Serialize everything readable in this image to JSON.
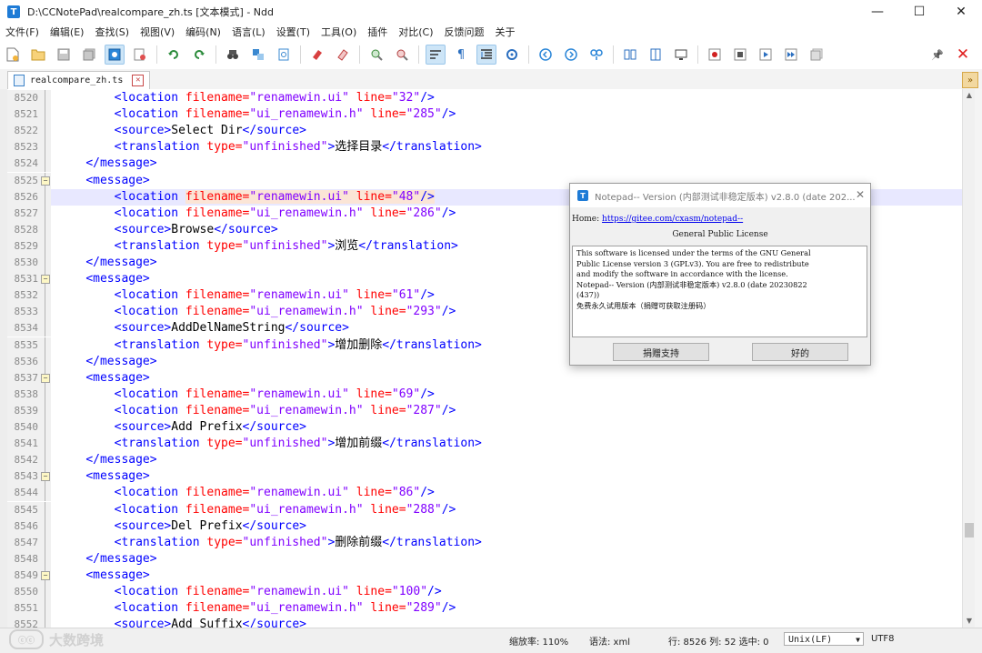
{
  "window": {
    "title": "D:\\CCNotePad\\realcompare_zh.ts [文本模式] - Ndd",
    "app_icon": "T",
    "controls": [
      "minimize-icon",
      "maximize-icon",
      "close-icon"
    ],
    "minimize_glyph": "—",
    "maximize_glyph": "☐",
    "close_glyph": "✕"
  },
  "menu": [
    "文件(F)",
    "编辑(E)",
    "查找(S)",
    "视图(V)",
    "编码(N)",
    "语言(L)",
    "设置(T)",
    "工具(O)",
    "插件",
    "对比(C)",
    "反馈问题",
    "关于"
  ],
  "toolbar": {
    "pin_glyph": "📌",
    "close_glyph": "✕"
  },
  "tab": {
    "label": "realcompare_zh.ts",
    "close_glyph": "✕",
    "scroll_glyph": "»"
  },
  "editor": {
    "current_line": "8526",
    "lines": [
      {
        "n": "8520",
        "fold": "line",
        "indent": "        ",
        "parts": [
          [
            "t-tag",
            "<location "
          ],
          [
            "t-attr",
            "filename="
          ],
          [
            "t-val",
            "\"renamewin.ui\""
          ],
          [
            "t-attr",
            " line="
          ],
          [
            "t-val",
            "\"32\""
          ],
          [
            "t-tag",
            "/>"
          ]
        ]
      },
      {
        "n": "8521",
        "fold": "line",
        "indent": "        ",
        "parts": [
          [
            "t-tag",
            "<location "
          ],
          [
            "t-attr",
            "filename="
          ],
          [
            "t-val",
            "\"ui_renamewin.h\""
          ],
          [
            "t-attr",
            " line="
          ],
          [
            "t-val",
            "\"285\""
          ],
          [
            "t-tag",
            "/>"
          ]
        ]
      },
      {
        "n": "8522",
        "fold": "line",
        "indent": "        ",
        "parts": [
          [
            "t-tag",
            "<source>"
          ],
          [
            "t-text",
            "Select Dir"
          ],
          [
            "t-tag",
            "</source>"
          ]
        ]
      },
      {
        "n": "8523",
        "fold": "line",
        "indent": "        ",
        "parts": [
          [
            "t-tag",
            "<translation "
          ],
          [
            "t-attr",
            "type="
          ],
          [
            "t-val",
            "\"unfinished\""
          ],
          [
            "t-tag",
            ">"
          ],
          [
            "t-text",
            "选择目录"
          ],
          [
            "t-tag",
            "</translation>"
          ]
        ]
      },
      {
        "n": "8524",
        "fold": "line",
        "indent": "    ",
        "parts": [
          [
            "t-tag",
            "</message>"
          ]
        ]
      },
      {
        "n": "8525",
        "fold": "box",
        "indent": "    ",
        "parts": [
          [
            "t-tag",
            "<message>"
          ]
        ]
      },
      {
        "n": "8526",
        "fold": "line",
        "indent": "        ",
        "parts": [
          [
            "t-tag",
            "<location "
          ],
          [
            "t-attr hl",
            "filename="
          ],
          [
            "t-val hl",
            "\"renamewin.ui\""
          ],
          [
            "t-attr hl",
            " line="
          ],
          [
            "t-val hl",
            "\"48\""
          ],
          [
            "t-tag hl",
            "/>"
          ]
        ]
      },
      {
        "n": "8527",
        "fold": "line",
        "indent": "        ",
        "parts": [
          [
            "t-tag",
            "<location "
          ],
          [
            "t-attr",
            "filename="
          ],
          [
            "t-val",
            "\"ui_renamewin.h\""
          ],
          [
            "t-attr",
            " line="
          ],
          [
            "t-val",
            "\"286\""
          ],
          [
            "t-tag",
            "/>"
          ]
        ]
      },
      {
        "n": "8528",
        "fold": "line",
        "indent": "        ",
        "parts": [
          [
            "t-tag",
            "<source>"
          ],
          [
            "t-text",
            "Browse"
          ],
          [
            "t-tag",
            "</source>"
          ]
        ]
      },
      {
        "n": "8529",
        "fold": "line",
        "indent": "        ",
        "parts": [
          [
            "t-tag",
            "<translation "
          ],
          [
            "t-attr",
            "type="
          ],
          [
            "t-val",
            "\"unfinished\""
          ],
          [
            "t-tag",
            ">"
          ],
          [
            "t-text",
            "浏览"
          ],
          [
            "t-tag",
            "</translation>"
          ]
        ]
      },
      {
        "n": "8530",
        "fold": "line",
        "indent": "    ",
        "parts": [
          [
            "t-tag",
            "</message>"
          ]
        ]
      },
      {
        "n": "8531",
        "fold": "box",
        "indent": "    ",
        "parts": [
          [
            "t-tag",
            "<message>"
          ]
        ]
      },
      {
        "n": "8532",
        "fold": "line",
        "indent": "        ",
        "parts": [
          [
            "t-tag",
            "<location "
          ],
          [
            "t-attr",
            "filename="
          ],
          [
            "t-val",
            "\"renamewin.ui\""
          ],
          [
            "t-attr",
            " line="
          ],
          [
            "t-val",
            "\"61\""
          ],
          [
            "t-tag",
            "/>"
          ]
        ]
      },
      {
        "n": "8533",
        "fold": "line",
        "indent": "        ",
        "parts": [
          [
            "t-tag",
            "<location "
          ],
          [
            "t-attr",
            "filename="
          ],
          [
            "t-val",
            "\"ui_renamewin.h\""
          ],
          [
            "t-attr",
            " line="
          ],
          [
            "t-val",
            "\"293\""
          ],
          [
            "t-tag",
            "/>"
          ]
        ]
      },
      {
        "n": "8534",
        "fold": "line",
        "indent": "        ",
        "parts": [
          [
            "t-tag",
            "<source>"
          ],
          [
            "t-text",
            "AddDelNameString"
          ],
          [
            "t-tag",
            "</source>"
          ]
        ]
      },
      {
        "n": "8535",
        "fold": "line",
        "indent": "        ",
        "parts": [
          [
            "t-tag",
            "<translation "
          ],
          [
            "t-attr",
            "type="
          ],
          [
            "t-val",
            "\"unfinished\""
          ],
          [
            "t-tag",
            ">"
          ],
          [
            "t-text",
            "增加删除"
          ],
          [
            "t-tag",
            "</translation>"
          ]
        ]
      },
      {
        "n": "8536",
        "fold": "line",
        "indent": "    ",
        "parts": [
          [
            "t-tag",
            "</message>"
          ]
        ]
      },
      {
        "n": "8537",
        "fold": "box",
        "indent": "    ",
        "parts": [
          [
            "t-tag",
            "<message>"
          ]
        ]
      },
      {
        "n": "8538",
        "fold": "line",
        "indent": "        ",
        "parts": [
          [
            "t-tag",
            "<location "
          ],
          [
            "t-attr",
            "filename="
          ],
          [
            "t-val",
            "\"renamewin.ui\""
          ],
          [
            "t-attr",
            " line="
          ],
          [
            "t-val",
            "\"69\""
          ],
          [
            "t-tag",
            "/>"
          ]
        ]
      },
      {
        "n": "8539",
        "fold": "line",
        "indent": "        ",
        "parts": [
          [
            "t-tag",
            "<location "
          ],
          [
            "t-attr",
            "filename="
          ],
          [
            "t-val",
            "\"ui_renamewin.h\""
          ],
          [
            "t-attr",
            " line="
          ],
          [
            "t-val",
            "\"287\""
          ],
          [
            "t-tag",
            "/>"
          ]
        ]
      },
      {
        "n": "8540",
        "fold": "line",
        "indent": "        ",
        "parts": [
          [
            "t-tag",
            "<source>"
          ],
          [
            "t-text",
            "Add Prefix"
          ],
          [
            "t-tag",
            "</source>"
          ]
        ]
      },
      {
        "n": "8541",
        "fold": "line",
        "indent": "        ",
        "parts": [
          [
            "t-tag",
            "<translation "
          ],
          [
            "t-attr",
            "type="
          ],
          [
            "t-val",
            "\"unfinished\""
          ],
          [
            "t-tag",
            ">"
          ],
          [
            "t-text",
            "增加前缀"
          ],
          [
            "t-tag",
            "</translation>"
          ]
        ]
      },
      {
        "n": "8542",
        "fold": "line",
        "indent": "    ",
        "parts": [
          [
            "t-tag",
            "</message>"
          ]
        ]
      },
      {
        "n": "8543",
        "fold": "box",
        "indent": "    ",
        "parts": [
          [
            "t-tag",
            "<message>"
          ]
        ]
      },
      {
        "n": "8544",
        "fold": "line",
        "indent": "        ",
        "parts": [
          [
            "t-tag",
            "<location "
          ],
          [
            "t-attr",
            "filename="
          ],
          [
            "t-val",
            "\"renamewin.ui\""
          ],
          [
            "t-attr",
            " line="
          ],
          [
            "t-val",
            "\"86\""
          ],
          [
            "t-tag",
            "/>"
          ]
        ]
      },
      {
        "n": "8545",
        "fold": "line",
        "indent": "        ",
        "parts": [
          [
            "t-tag",
            "<location "
          ],
          [
            "t-attr",
            "filename="
          ],
          [
            "t-val",
            "\"ui_renamewin.h\""
          ],
          [
            "t-attr",
            " line="
          ],
          [
            "t-val",
            "\"288\""
          ],
          [
            "t-tag",
            "/>"
          ]
        ]
      },
      {
        "n": "8546",
        "fold": "line",
        "indent": "        ",
        "parts": [
          [
            "t-tag",
            "<source>"
          ],
          [
            "t-text",
            "Del Prefix"
          ],
          [
            "t-tag",
            "</source>"
          ]
        ]
      },
      {
        "n": "8547",
        "fold": "line",
        "indent": "        ",
        "parts": [
          [
            "t-tag",
            "<translation "
          ],
          [
            "t-attr",
            "type="
          ],
          [
            "t-val",
            "\"unfinished\""
          ],
          [
            "t-tag",
            ">"
          ],
          [
            "t-text",
            "删除前缀"
          ],
          [
            "t-tag",
            "</translation>"
          ]
        ]
      },
      {
        "n": "8548",
        "fold": "line",
        "indent": "    ",
        "parts": [
          [
            "t-tag",
            "</message>"
          ]
        ]
      },
      {
        "n": "8549",
        "fold": "box",
        "indent": "    ",
        "parts": [
          [
            "t-tag",
            "<message>"
          ]
        ]
      },
      {
        "n": "8550",
        "fold": "line",
        "indent": "        ",
        "parts": [
          [
            "t-tag",
            "<location "
          ],
          [
            "t-attr",
            "filename="
          ],
          [
            "t-val",
            "\"renamewin.ui\""
          ],
          [
            "t-attr",
            " line="
          ],
          [
            "t-val",
            "\"100\""
          ],
          [
            "t-tag",
            "/>"
          ]
        ]
      },
      {
        "n": "8551",
        "fold": "line",
        "indent": "        ",
        "parts": [
          [
            "t-tag",
            "<location "
          ],
          [
            "t-attr",
            "filename="
          ],
          [
            "t-val",
            "\"ui_renamewin.h\""
          ],
          [
            "t-attr",
            " line="
          ],
          [
            "t-val",
            "\"289\""
          ],
          [
            "t-tag",
            "/>"
          ]
        ]
      },
      {
        "n": "8552",
        "fold": "line",
        "indent": "        ",
        "parts": [
          [
            "t-tag",
            "<source>"
          ],
          [
            "t-text",
            "Add Suffix"
          ],
          [
            "t-tag",
            "</source>"
          ]
        ]
      }
    ]
  },
  "status": {
    "zoom": "缩放率: 110%",
    "lang": "语法: xml",
    "position": "行: 8526 列: 52 选中: 0",
    "eol": "Unix(LF)",
    "encoding": "UTF8",
    "dropdown_glyph": "▼"
  },
  "watermark": {
    "logo": "ⓒⓒ",
    "text": "大数跨境"
  },
  "about_dialog": {
    "title": "Notepad-- Version (内部测试非稳定版本) v2.8.0 (date 202...",
    "close_glyph": "✕",
    "home_label": "Home: ",
    "home_url": "https://gitee.com/cxasm/notepad--",
    "license_heading": "General Public License",
    "license_lines": [
      "This software is licensed under the terms of the GNU General",
      "Public License version 3 (GPLv3). You are free to redistribute",
      "and modify the software in accordance with the license.",
      "Notepad-- Version (内部测试非稳定版本) v2.8.0 (date 20230822",
      "(437))",
      "免费永久试用版本（捐赠可获取注册码）"
    ],
    "donate_button": "捐赠支持",
    "ok_button": "好的"
  }
}
